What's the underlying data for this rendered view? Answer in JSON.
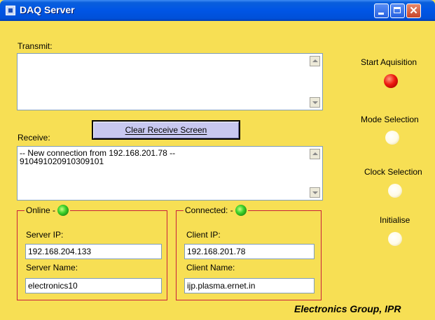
{
  "window": {
    "title": "DAQ Server"
  },
  "transmit": {
    "label": "Transmit:",
    "content": ""
  },
  "receive": {
    "label": "Receive:",
    "lines": [
      "-- New connection from 192.168.201.78 --",
      "910491020910309101"
    ]
  },
  "clear_button": {
    "label": "Clear Receive Screen"
  },
  "online_group": {
    "title": "Online -",
    "server_ip_label": "Server IP:",
    "server_ip_value": "192.168.204.133",
    "server_name_label": "Server Name:",
    "server_name_value": "electronics10"
  },
  "connected_group": {
    "title": "Connected: -",
    "client_ip_label": "Client IP:",
    "client_ip_value": "192.168.201.78",
    "client_name_label": "Client Name:",
    "client_name_value": "ijp.plasma.ernet.in"
  },
  "controls": [
    {
      "label": "Start Aquisition",
      "state": "red"
    },
    {
      "label": "Mode Selection",
      "state": "off"
    },
    {
      "label": "Clock Selection",
      "state": "off"
    },
    {
      "label": "Initialise",
      "state": "off"
    }
  ],
  "footer": {
    "text": "Electronics Group, IPR"
  },
  "colors": {
    "background": "#f7df54",
    "group_border": "#c8203c",
    "titlebar": "#0055e5"
  }
}
